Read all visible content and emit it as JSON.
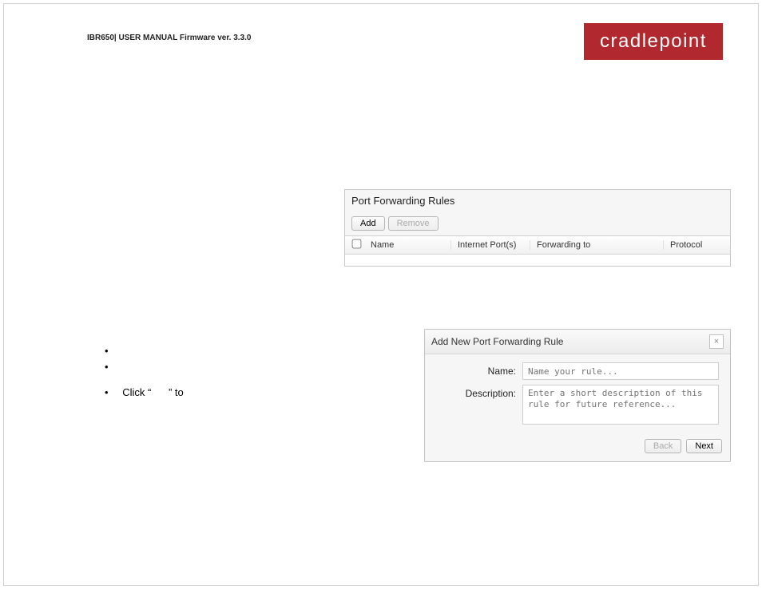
{
  "doc": {
    "header_text": "IBR650| USER MANUAL Firmware ver. 3.3.0",
    "brand": "cradlepoint"
  },
  "rules_panel": {
    "title": "Port Forwarding Rules",
    "add_label": "Add",
    "remove_label": "Remove",
    "columns": {
      "name": "Name",
      "internet_ports": "Internet Port(s)",
      "forwarding_to": "Forwarding to",
      "protocol": "Protocol"
    }
  },
  "bullets": {
    "step_prefix": "Click “",
    "step_suffix": "” to"
  },
  "modal": {
    "title": "Add New Port Forwarding Rule",
    "close_glyph": "×",
    "name_label": "Name:",
    "name_placeholder": "Name your rule...",
    "desc_label": "Description:",
    "desc_placeholder": "Enter a short description of this rule for future reference...",
    "back_label": "Back",
    "next_label": "Next"
  }
}
